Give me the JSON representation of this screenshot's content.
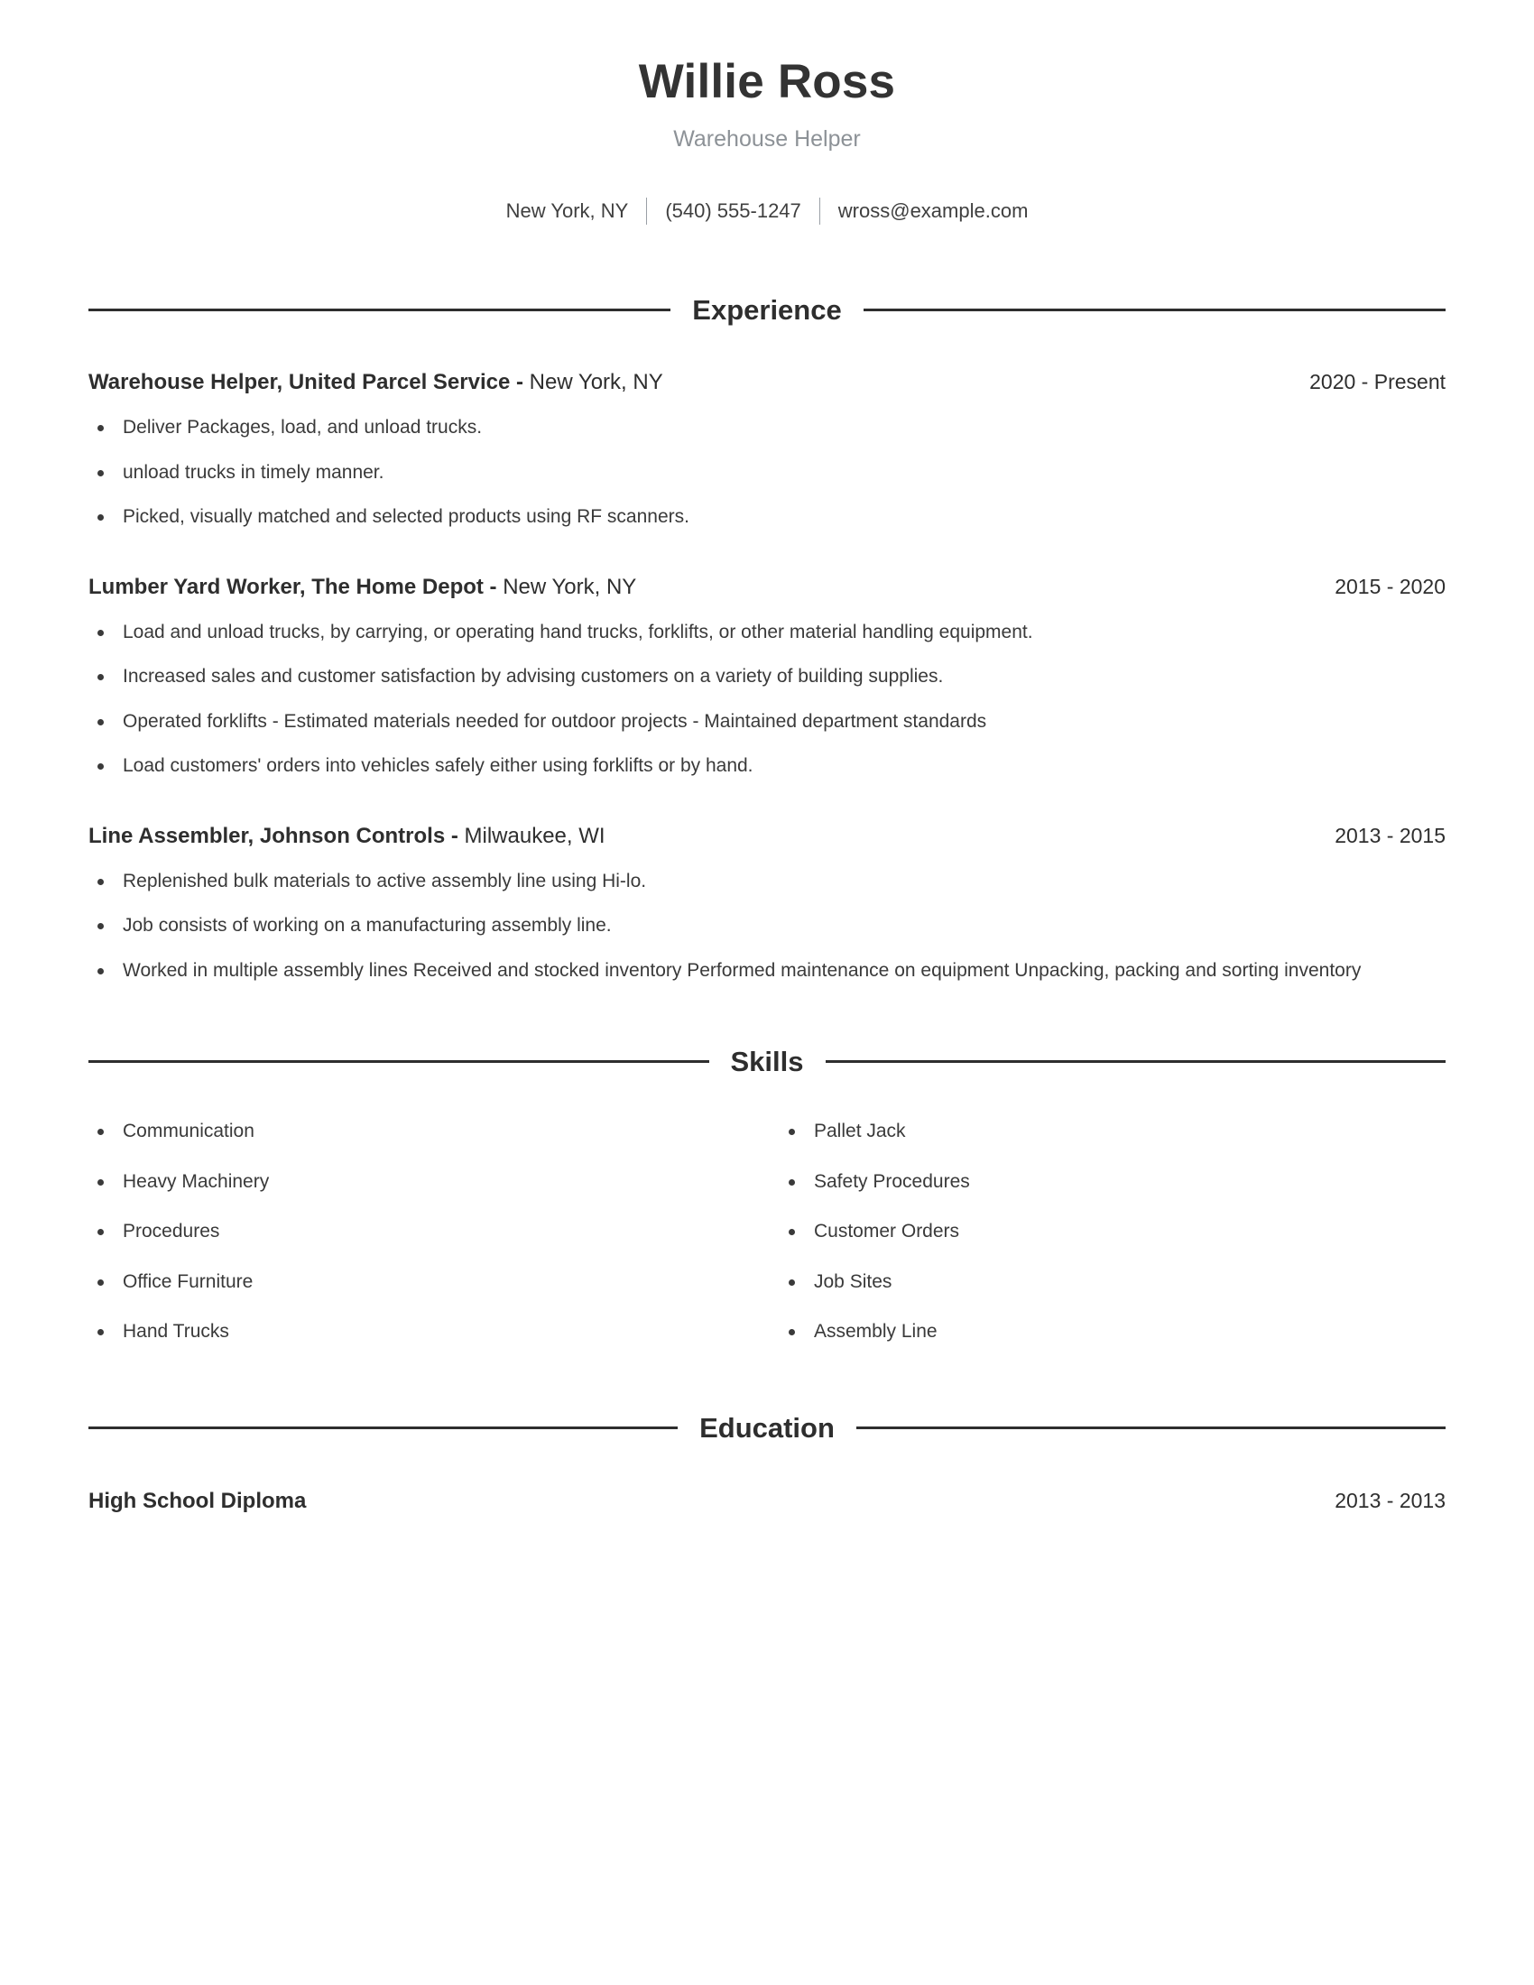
{
  "theme": {
    "text_color": "#3a3a3a",
    "heading_color": "#2e2e2e",
    "subtitle_color": "#8d9297",
    "rule_color": "#2e2e2e",
    "background": "#ffffff"
  },
  "header": {
    "name": "Willie Ross",
    "subtitle": "Warehouse Helper",
    "contact": {
      "location": "New York, NY",
      "phone": "(540) 555-1247",
      "email": "wross@example.com"
    }
  },
  "sections": {
    "experience": {
      "title": "Experience",
      "entries": [
        {
          "role_company": "Warehouse Helper, United Parcel Service - ",
          "location": "New York, NY",
          "dates": "2020 - Present",
          "bullets": [
            "Deliver Packages, load, and unload trucks.",
            "unload trucks in timely manner.",
            "Picked, visually matched and selected products using RF scanners."
          ]
        },
        {
          "role_company": "Lumber Yard Worker, The Home Depot - ",
          "location": "New York, NY",
          "dates": "2015 - 2020",
          "bullets": [
            "Load and unload trucks, by carrying, or operating hand trucks, forklifts, or other material handling equipment.",
            "Increased sales and customer satisfaction by advising customers on a variety of building supplies.",
            "Operated forklifts - Estimated materials needed for outdoor projects - Maintained department standards",
            "Load customers' orders into vehicles safely either using forklifts or by hand."
          ]
        },
        {
          "role_company": "Line Assembler, Johnson Controls - ",
          "location": "Milwaukee, WI",
          "dates": "2013 - 2015",
          "bullets": [
            "Replenished bulk materials to active assembly line using Hi-lo.",
            "Job consists of working on a manufacturing assembly line.",
            "Worked in multiple assembly lines Received and stocked inventory Performed maintenance on equipment Unpacking, packing and sorting inventory"
          ]
        }
      ]
    },
    "skills": {
      "title": "Skills",
      "left_column": [
        "Communication",
        "Heavy Machinery",
        "Procedures",
        "Office Furniture",
        "Hand Trucks"
      ],
      "right_column": [
        "Pallet Jack",
        "Safety Procedures",
        "Customer Orders",
        "Job Sites",
        "Assembly Line"
      ]
    },
    "education": {
      "title": "Education",
      "entries": [
        {
          "degree": "High School Diploma",
          "dates": "2013 - 2013"
        }
      ]
    }
  }
}
